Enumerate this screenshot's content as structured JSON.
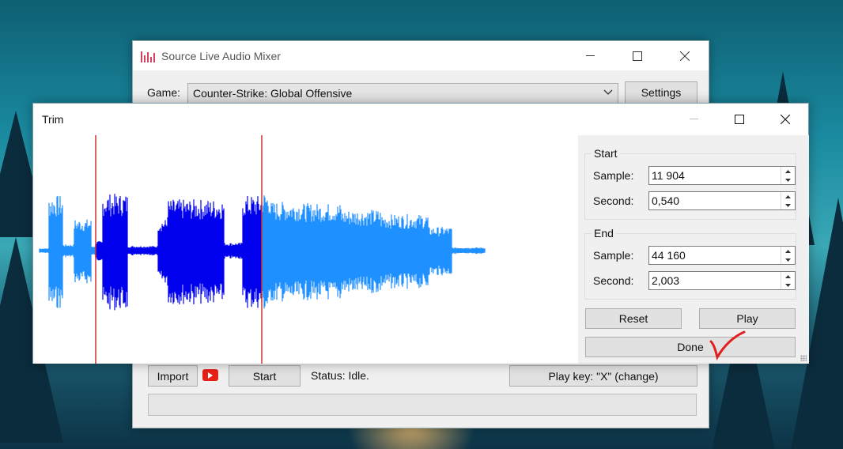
{
  "main_window": {
    "title": "Source Live Audio Mixer",
    "game_label": "Game:",
    "game_value": "Counter-Strike: Global Offensive",
    "settings_label": "Settings",
    "import_label": "Import",
    "start_label": "Start",
    "status_text": "Status: Idle.",
    "play_key_label": "Play key: \"X\" (change)"
  },
  "trim_window": {
    "title": "Trim",
    "start": {
      "group_title": "Start",
      "sample_label": "Sample:",
      "sample_value": "11 904",
      "second_label": "Second:",
      "second_value": "0,540"
    },
    "end": {
      "group_title": "End",
      "sample_label": "Sample:",
      "sample_value": "44 160",
      "second_label": "Second:",
      "second_value": "2,003"
    },
    "reset_label": "Reset",
    "play_label": "Play",
    "done_label": "Done"
  },
  "waveform": {
    "total_seconds": 2.003,
    "selection_start_second": 0.54,
    "selection_end_second": 2.003,
    "unselected_color": "#1e90ff",
    "selected_color": "#0000ee",
    "marker_color": "#d03030"
  },
  "icons": {
    "app": "equalizer-icon",
    "youtube": "youtube-icon",
    "annotation": "red-checkmark-icon"
  }
}
